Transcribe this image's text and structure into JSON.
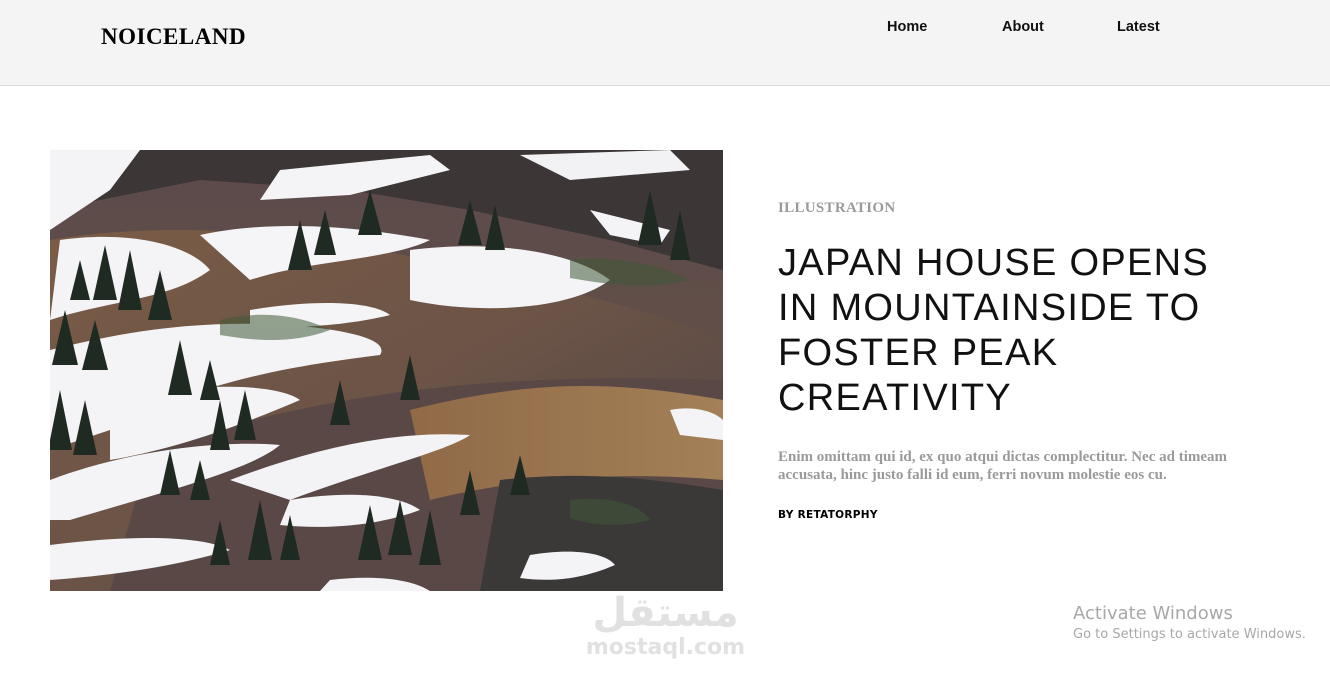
{
  "header": {
    "brand": "NOICELAND",
    "nav": [
      {
        "label": "Home"
      },
      {
        "label": "About"
      },
      {
        "label": "Latest"
      }
    ]
  },
  "article": {
    "category": "ILLUSTRATION",
    "title": "JAPAN HOUSE OPENS IN MOUNTAINSIDE TO FOSTER PEAK CREATIVITY",
    "excerpt": "Enim omittam qui id, ex quo atqui dictas complectitur. Nec ad timeam accusata, hinc justo falli id eum, ferri novum molestie eos cu.",
    "author": "BY RETATORPHY"
  },
  "watermark": {
    "arabic": "مستقل",
    "latin": "mostaql.com"
  },
  "os_notice": {
    "title": "Activate Windows",
    "subtitle": "Go to Settings to activate Windows."
  },
  "colors": {
    "header_bg": "#f4f4f4",
    "muted_text": "#9a9a9a",
    "text": "#111111"
  }
}
